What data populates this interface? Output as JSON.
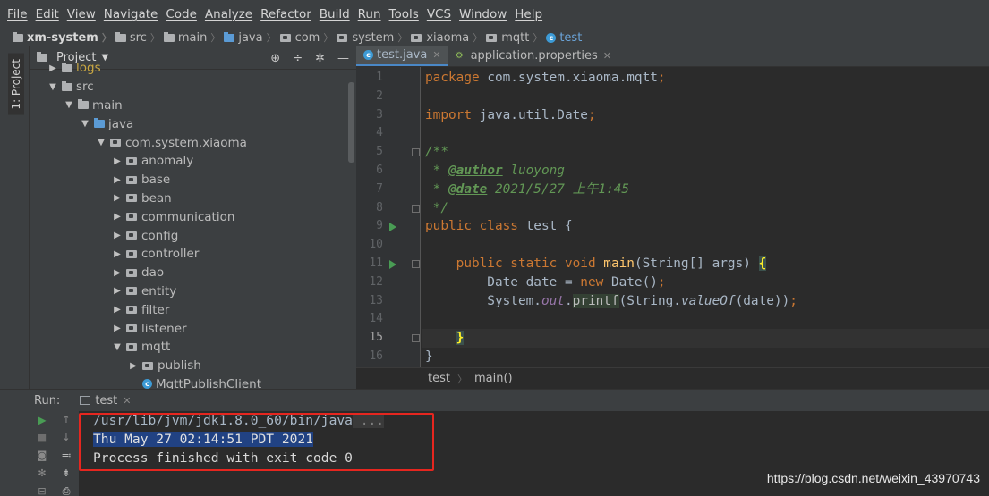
{
  "menubar": {
    "items": [
      "File",
      "Edit",
      "View",
      "Navigate",
      "Code",
      "Analyze",
      "Refactor",
      "Build",
      "Run",
      "Tools",
      "VCS",
      "Window",
      "Help"
    ]
  },
  "navbar": {
    "crumbs": [
      "xm-system",
      "src",
      "main",
      "java",
      "com",
      "system",
      "xiaoma",
      "mqtt",
      "test"
    ]
  },
  "left_strip": {
    "tab_label": "1: Project"
  },
  "project_panel": {
    "title": "Project",
    "tree": [
      {
        "label": "logs",
        "indent": 0,
        "arrow": "▶"
      },
      {
        "label": "src",
        "indent": 0,
        "arrow": "▼"
      },
      {
        "label": "main",
        "indent": 1,
        "arrow": "▼"
      },
      {
        "label": "java",
        "indent": 2,
        "arrow": "▼"
      },
      {
        "label": "com.system.xiaoma",
        "indent": 3,
        "arrow": "▼"
      },
      {
        "label": "anomaly",
        "indent": 4,
        "arrow": "▶"
      },
      {
        "label": "base",
        "indent": 4,
        "arrow": "▶"
      },
      {
        "label": "bean",
        "indent": 4,
        "arrow": "▶"
      },
      {
        "label": "communication",
        "indent": 4,
        "arrow": "▶"
      },
      {
        "label": "config",
        "indent": 4,
        "arrow": "▶"
      },
      {
        "label": "controller",
        "indent": 4,
        "arrow": "▶"
      },
      {
        "label": "dao",
        "indent": 4,
        "arrow": "▶"
      },
      {
        "label": "entity",
        "indent": 4,
        "arrow": "▶"
      },
      {
        "label": "filter",
        "indent": 4,
        "arrow": "▶"
      },
      {
        "label": "listener",
        "indent": 4,
        "arrow": "▶"
      },
      {
        "label": "mqtt",
        "indent": 4,
        "arrow": "▼"
      },
      {
        "label": "publish",
        "indent": 5,
        "arrow": "▶"
      },
      {
        "label": "MqttPublishClient",
        "indent": 5,
        "arrow": ""
      }
    ]
  },
  "editor": {
    "tabs": [
      {
        "label": "test.java",
        "active": true
      },
      {
        "label": "application.properties",
        "active": false
      }
    ],
    "current_line": 15,
    "lines": [
      [
        {
          "t": "package ",
          "c": "kw"
        },
        {
          "t": "com.system.xiaoma.mqtt",
          "c": "pl"
        },
        {
          "t": ";",
          "c": "kw"
        }
      ],
      [],
      [
        {
          "t": "import ",
          "c": "kw"
        },
        {
          "t": "java.util.Date",
          "c": "pl"
        },
        {
          "t": ";",
          "c": "kw"
        }
      ],
      [],
      [
        {
          "t": "/**",
          "c": "cm"
        }
      ],
      [
        {
          "t": " * ",
          "c": "cm"
        },
        {
          "t": "@author",
          "c": "tag"
        },
        {
          "t": " luoyong",
          "c": "cm"
        }
      ],
      [
        {
          "t": " * ",
          "c": "cm"
        },
        {
          "t": "@date",
          "c": "tag"
        },
        {
          "t": " 2021/5/27 上午1:45",
          "c": "cm"
        }
      ],
      [
        {
          "t": " */",
          "c": "cm"
        }
      ],
      [
        {
          "t": "public class ",
          "c": "kw"
        },
        {
          "t": "test {",
          "c": "pl"
        }
      ],
      [],
      [
        {
          "t": "    public static void ",
          "c": "kw"
        },
        {
          "t": "main",
          "c": "fn"
        },
        {
          "t": "(String[] args) ",
          "c": "pl"
        },
        {
          "t": "{",
          "c": "brace"
        }
      ],
      [
        {
          "t": "        Date date = ",
          "c": "pl"
        },
        {
          "t": "new ",
          "c": "kw"
        },
        {
          "t": "Date()",
          "c": "pl"
        },
        {
          "t": ";",
          "c": "kw"
        }
      ],
      [
        {
          "t": "        System.",
          "c": "pl"
        },
        {
          "t": "out",
          "c": "it"
        },
        {
          "t": ".",
          "c": "pl"
        },
        {
          "t": "printf",
          "c": "hl"
        },
        {
          "t": "(String.",
          "c": "pl"
        },
        {
          "t": "valueOf",
          "c": "sm"
        },
        {
          "t": "(date))",
          "c": "pl"
        },
        {
          "t": ";",
          "c": "kw"
        }
      ],
      [],
      [
        {
          "t": "    ",
          "c": "pl"
        },
        {
          "t": "}",
          "c": "brace"
        }
      ],
      [
        {
          "t": "}",
          "c": "pl"
        }
      ]
    ],
    "run_markers": [
      9,
      11
    ],
    "fold_markers": [
      5,
      8,
      11,
      15
    ],
    "breadcrumb": [
      "test",
      "main()"
    ]
  },
  "run_panel": {
    "label": "Run:",
    "tab": "test",
    "console": {
      "command": "/usr/lib/jvm/jdk1.8.0_60/bin/java",
      "dots": " ...",
      "output": "Thu May 27 02:14:51 PDT 2021",
      "exit": "Process finished with exit code 0"
    }
  },
  "watermark": "https://blog.csdn.net/weixin_43970743"
}
